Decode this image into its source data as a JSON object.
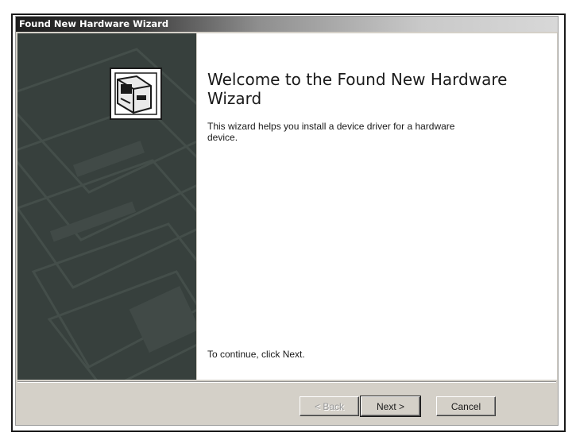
{
  "window": {
    "title": "Found New Hardware Wizard"
  },
  "content": {
    "heading": "Welcome to the Found New Hardware Wizard",
    "description": "This wizard helps you install a device driver for a hardware device.",
    "footer": "To continue, click Next."
  },
  "buttons": {
    "back": "< Back",
    "next": "Next >",
    "cancel": "Cancel"
  },
  "colors": {
    "panel": "#37403d",
    "dialog": "#d4d0c8"
  },
  "icons": [
    "hardware-drive-icon"
  ]
}
